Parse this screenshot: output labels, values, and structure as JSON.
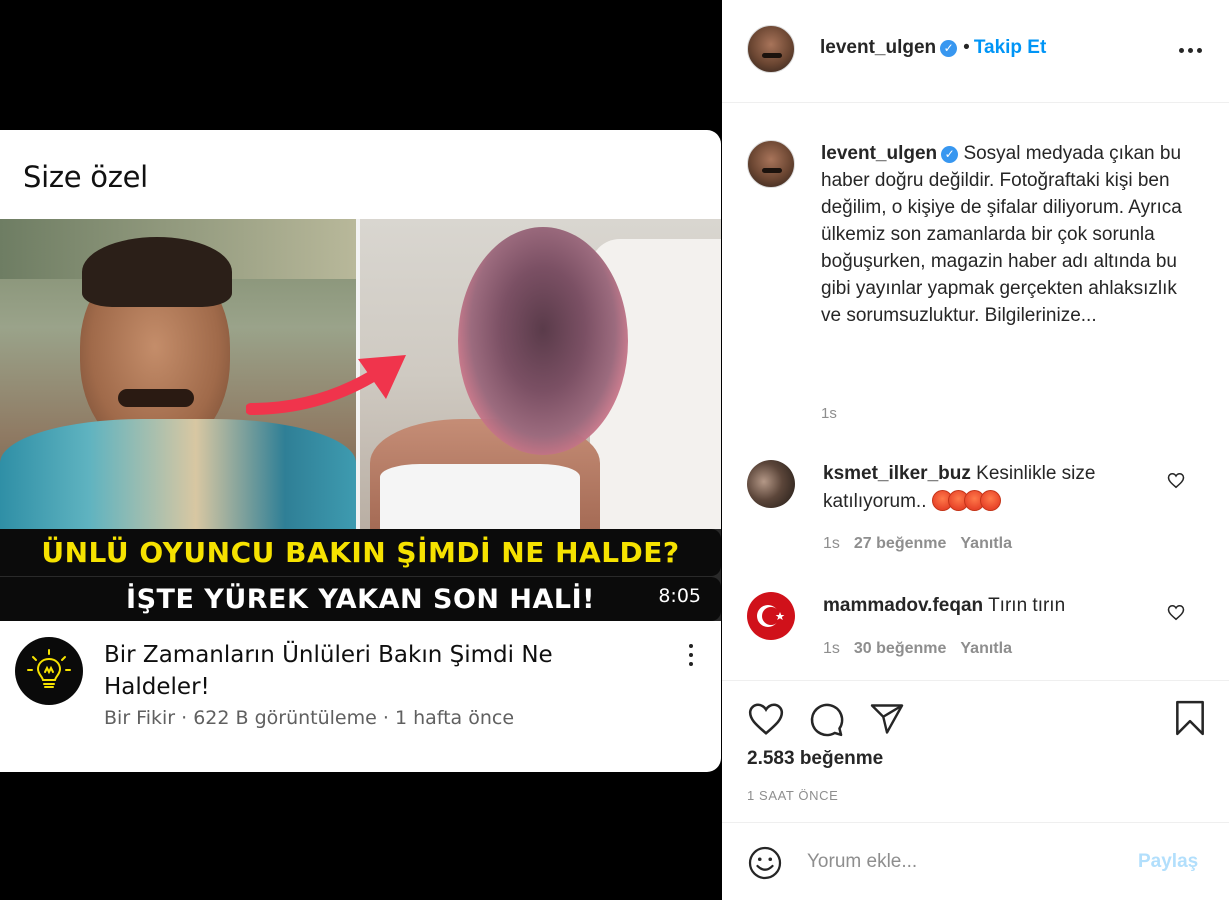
{
  "youtube_card": {
    "section_title": "Size özel",
    "banner_line1": "ÜNLÜ OYUNCU BAKIN ŞİMDİ NE HALDE?",
    "banner_line2": "İŞTE YÜREK YAKAN SON HALİ!",
    "duration": "8:05",
    "video_title": "Bir Zamanların Ünlüleri Bakın Şimdi Ne Haldeler!",
    "meta": "Bir Fikir · 622 B görüntüleme · 1 hafta önce",
    "channel_avatar_icon": "lightbulb-icon",
    "more_icon": "vertical-dots-icon"
  },
  "post": {
    "header": {
      "username": "levent_ulgen",
      "verified": true,
      "follow_label": "Takip Et",
      "more_icon": "horizontal-dots-icon"
    },
    "caption": {
      "username": "levent_ulgen",
      "text": "Sosyal medyada çıkan bu haber doğru değildir. Fotoğraftaki kişi ben değilim, o kişiye de şifalar diliyorum. Ayrıca ülkemiz son zamanlarda bir çok sorunla boğuşurken, magazin haber adı altında bu gibi yayınlar yapmak gerçekten ahlaksızlık ve sorumsuzluktur. Bilgilerinize...",
      "time": "1s"
    },
    "comments": [
      {
        "username": "ksmet_ilker_buz",
        "text": "Kesinlikle size katılıyorum..",
        "emoji": "😡😡😡😡",
        "time": "1s",
        "likes": "27 beğenme",
        "reply_label": "Yanıtla"
      },
      {
        "username": "mammadov.feqan",
        "text": "Tırın tırın",
        "time": "1s",
        "likes": "30 beğenme",
        "reply_label": "Yanıtla"
      }
    ],
    "actions": {
      "icons": [
        "heart-icon",
        "comment-icon",
        "share-icon",
        "bookmark-icon"
      ]
    },
    "likes_count": "2.583 beğenme",
    "posted_time": "1 SAAT ÖNCE",
    "composer": {
      "emoji_icon": "smiley-icon",
      "placeholder": "Yorum ekle...",
      "post_label": "Paylaş"
    }
  },
  "colors": {
    "accent_blue": "#0095f6",
    "post_button_disabled": "#b2dffc",
    "banner_yellow": "#f6e200",
    "verified_blue": "#3897f0"
  }
}
